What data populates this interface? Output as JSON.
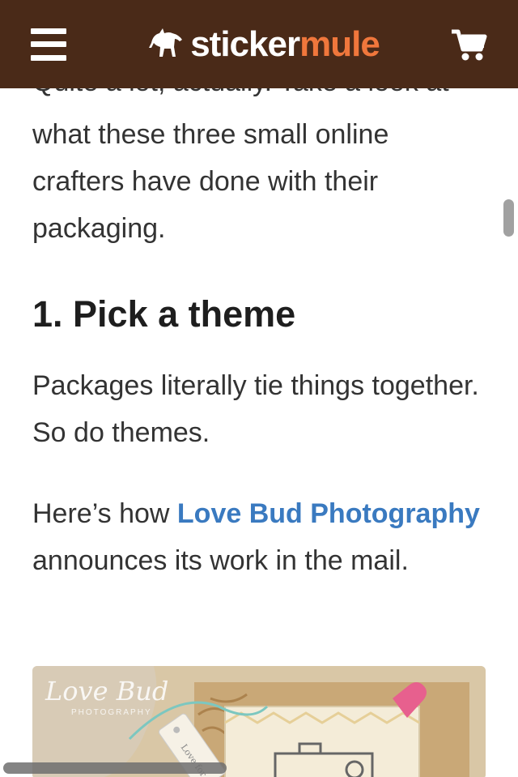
{
  "header": {
    "logo_part1": "sticker",
    "logo_part2": "mule",
    "colors": {
      "bar": "#4a2a18",
      "logo_accent": "#f0773c"
    }
  },
  "article": {
    "clipped_line": "Quite a lot, actually. Take a look at",
    "intro": "what these three small online crafters have done with their packaging.",
    "heading": "1. Pick a theme",
    "theme_text": "Packages literally tie things together. So do themes.",
    "lovebud_prefix": "Here’s how ",
    "lovebud_link": "Love Bud Photography",
    "lovebud_suffix": " announces its work in the mail.",
    "link_color": "#3a7ac0"
  },
  "photo": {
    "watermark_script": "Love Bud",
    "watermark_small": "PHOTOGRAPHY",
    "tag_text": "Love for the"
  }
}
